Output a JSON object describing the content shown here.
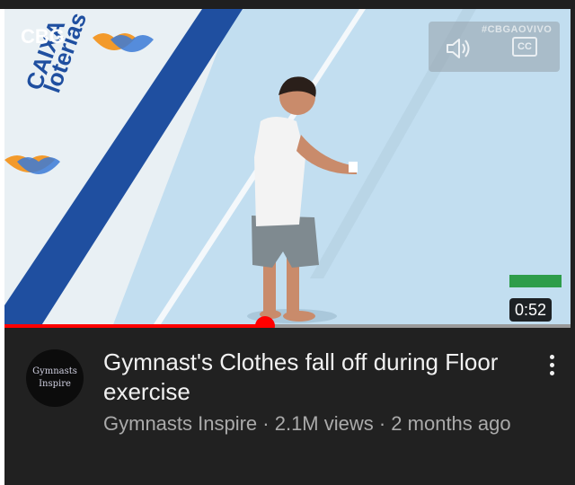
{
  "video": {
    "overlay_hashtag": "#CBGAOVIVO",
    "channel_logo_text": "CBG",
    "sponsor_text": "loterias CAIXA",
    "duration": "0:52",
    "progress_fraction": 0.46,
    "speaker_icon": "speaker-icon",
    "cc_label": "CC"
  },
  "info": {
    "avatar_line1": "Gymnasts",
    "avatar_line2": "Inspire",
    "title": "Gymnast's Clothes fall off during Floor exercise",
    "meta": "Gymnasts Inspire · 2.1M views · 2 months ago",
    "more_icon": "more-vert-icon"
  },
  "colors": {
    "progress": "#ff0000",
    "background": "#212121",
    "floor": "#c6e1f1"
  }
}
